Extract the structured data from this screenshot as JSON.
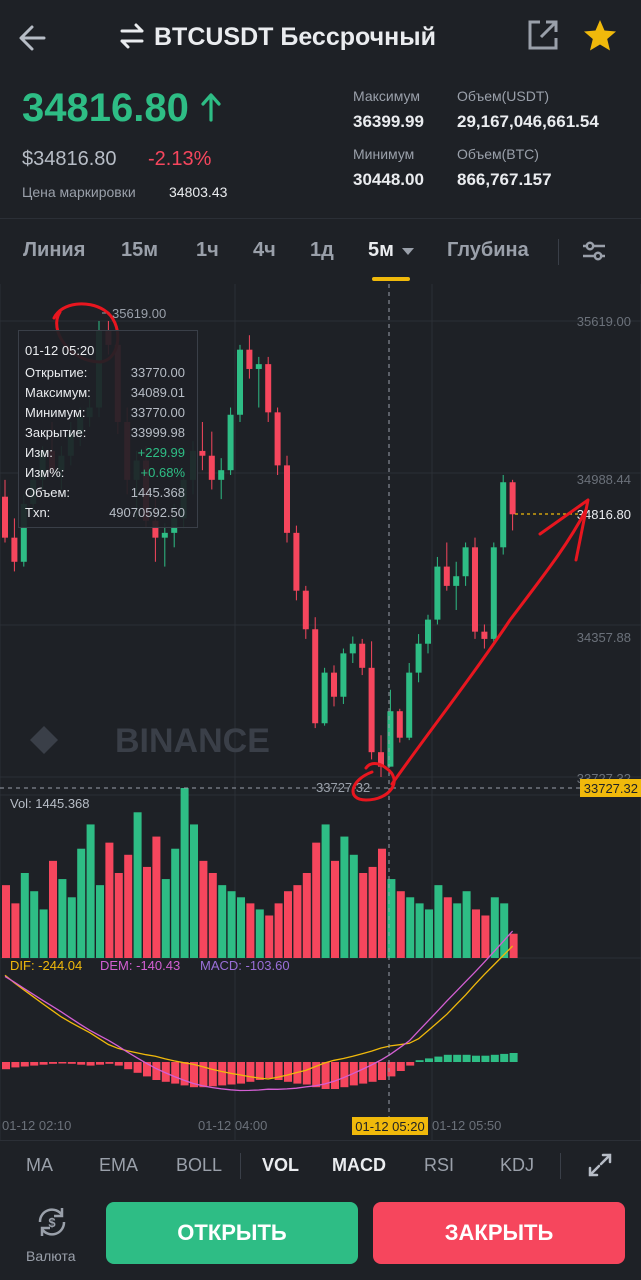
{
  "header": {
    "title": "BTCUSDT Бессрочный",
    "back_icon": "arrow-left-icon",
    "swap_icon": "swap-icon",
    "share_icon": "share-icon",
    "favorite_icon": "star-icon"
  },
  "ticker": {
    "price": "34816.80",
    "price_usd": "$34816.80",
    "change_pct": "-2.13%",
    "mark_label": "Цена маркировки",
    "mark_price": "34803.43",
    "high_label": "Максимум",
    "high": "36399.99",
    "low_label": "Минимум",
    "low": "30448.00",
    "vol_usdt_label": "Объем(USDT)",
    "vol_usdt": "29,167,046,661.54",
    "vol_btc_label": "Объем(BTC)",
    "vol_btc": "866,767.157"
  },
  "tabs": [
    "Линия",
    "15м",
    "1ч",
    "4ч",
    "1д",
    "5м",
    "Глубина"
  ],
  "active_tab": "5м",
  "tooltip": {
    "time": "01-12 05:20",
    "rows": [
      {
        "label": "Открытие:",
        "value": "33770.00"
      },
      {
        "label": "Максимум:",
        "value": "34089.01"
      },
      {
        "label": "Минимум:",
        "value": "33770.00"
      },
      {
        "label": "Закрытие:",
        "value": "33999.98"
      },
      {
        "label": "Изм:",
        "value": "+229.99"
      },
      {
        "label": "Изм%:",
        "value": "+0.68%"
      },
      {
        "label": "Объем:",
        "value": "1445.368"
      },
      {
        "label": "Txn:",
        "value": "49070592.50"
      }
    ]
  },
  "chart_data": {
    "type": "candlestick",
    "price_axis": [
      "35619.00",
      "34988.44",
      "34357.88",
      "33727.32"
    ],
    "current_price_label": "34816.80",
    "crosshair_price": "33727.32",
    "high_label": "35619.00",
    "low_label": "33727.32",
    "watermark": "BINANCE",
    "vol_label": "Vol: 1445.368",
    "macd_labels": {
      "dif": "DIF: -244.04",
      "dem": "DEM: -140.43",
      "macd": "MACD: -103.60"
    },
    "time_labels": [
      "01-12 02:10",
      "01-12 04:00",
      "01-12 05:20",
      "01-12 05:50"
    ],
    "candles": [
      [
        34890,
        34960,
        34700,
        34720
      ],
      [
        34720,
        34800,
        34580,
        34620
      ],
      [
        34620,
        34900,
        34600,
        34860
      ],
      [
        34860,
        35000,
        34820,
        34960
      ],
      [
        34960,
        35100,
        34920,
        35080
      ],
      [
        35080,
        35200,
        34980,
        35000
      ],
      [
        35000,
        35100,
        34920,
        35060
      ],
      [
        35060,
        35200,
        35020,
        35150
      ],
      [
        35150,
        35260,
        35100,
        35220
      ],
      [
        35220,
        35300,
        35180,
        35260
      ],
      [
        35260,
        35619,
        35220,
        35580
      ],
      [
        35580,
        35619,
        35480,
        35520
      ],
      [
        35520,
        35560,
        35150,
        35200
      ],
      [
        35200,
        35260,
        34900,
        34960
      ],
      [
        34960,
        35080,
        34800,
        35040
      ],
      [
        35040,
        35100,
        34760,
        34790
      ],
      [
        34790,
        34900,
        34620,
        34720
      ],
      [
        34720,
        34780,
        34600,
        34740
      ],
      [
        34740,
        34860,
        34680,
        34800
      ],
      [
        34800,
        35000,
        34760,
        34960
      ],
      [
        34960,
        35120,
        34900,
        35080
      ],
      [
        35080,
        35200,
        35000,
        35060
      ],
      [
        35060,
        35160,
        34920,
        34960
      ],
      [
        34960,
        35050,
        34880,
        35000
      ],
      [
        35000,
        35260,
        34980,
        35230
      ],
      [
        35230,
        35520,
        35200,
        35500
      ],
      [
        35500,
        35560,
        35380,
        35420
      ],
      [
        35420,
        35470,
        35260,
        35440
      ],
      [
        35440,
        35470,
        35200,
        35240
      ],
      [
        35240,
        35260,
        34980,
        35020
      ],
      [
        35020,
        35060,
        34700,
        34740
      ],
      [
        34740,
        34770,
        34460,
        34500
      ],
      [
        34500,
        34520,
        34300,
        34340
      ],
      [
        34340,
        34390,
        33930,
        33950
      ],
      [
        33950,
        34180,
        33940,
        34160
      ],
      [
        34160,
        34190,
        34020,
        34060
      ],
      [
        34060,
        34260,
        34030,
        34240
      ],
      [
        34240,
        34310,
        34200,
        34280
      ],
      [
        34280,
        34300,
        34150,
        34180
      ],
      [
        34180,
        34290,
        33800,
        33830
      ],
      [
        33830,
        33900,
        33727,
        33770
      ],
      [
        33770,
        34089,
        33770,
        34000
      ],
      [
        34000,
        34010,
        33870,
        33890
      ],
      [
        33890,
        34200,
        33880,
        34160
      ],
      [
        34160,
        34320,
        34120,
        34280
      ],
      [
        34280,
        34400,
        34240,
        34380
      ],
      [
        34380,
        34640,
        34360,
        34600
      ],
      [
        34600,
        34700,
        34500,
        34520
      ],
      [
        34520,
        34620,
        34420,
        34560
      ],
      [
        34560,
        34700,
        34520,
        34680
      ],
      [
        34680,
        34720,
        34300,
        34330
      ],
      [
        34330,
        34360,
        34260,
        34300
      ],
      [
        34300,
        34700,
        34280,
        34680
      ],
      [
        34680,
        34980,
        34650,
        34950
      ],
      [
        34950,
        34960,
        34750,
        34817
      ]
    ],
    "volume": [
      60,
      45,
      70,
      55,
      40,
      80,
      65,
      50,
      90,
      110,
      60,
      95,
      70,
      85,
      120,
      75,
      100,
      65,
      90,
      140,
      110,
      80,
      70,
      60,
      55,
      50,
      45,
      40,
      35,
      45,
      55,
      60,
      70,
      95,
      110,
      80,
      100,
      85,
      70,
      75,
      90,
      65,
      55,
      50,
      45,
      40,
      60,
      50,
      45,
      55,
      40,
      35,
      50,
      45,
      20
    ],
    "macd_hist": [
      -8,
      -6,
      -5,
      -4,
      -3,
      -2,
      -1,
      -2,
      -3,
      -4,
      -3,
      -2,
      -4,
      -8,
      -12,
      -16,
      -20,
      -22,
      -24,
      -26,
      -28,
      -28,
      -27,
      -26,
      -25,
      -24,
      -22,
      -20,
      -18,
      -20,
      -22,
      -24,
      -25,
      -28,
      -30,
      -30,
      -28,
      -26,
      -24,
      -22,
      -20,
      -16,
      -10,
      -4,
      2,
      4,
      6,
      8,
      8,
      8,
      7,
      7,
      8,
      9,
      10
    ]
  },
  "indicators": [
    "MA",
    "EMA",
    "BOLL",
    "VOL",
    "MACD",
    "RSI",
    "KDJ"
  ],
  "active_indicators": [
    "VOL",
    "MACD"
  ],
  "footer": {
    "currency_label": "Валюта",
    "open_label": "ОТКРЫТЬ",
    "close_label": "ЗАКРЫТЬ"
  },
  "colors": {
    "green": "#2ebd85",
    "red": "#f6465d",
    "accent": "#f0b90b",
    "annotation": "#e8161f"
  }
}
